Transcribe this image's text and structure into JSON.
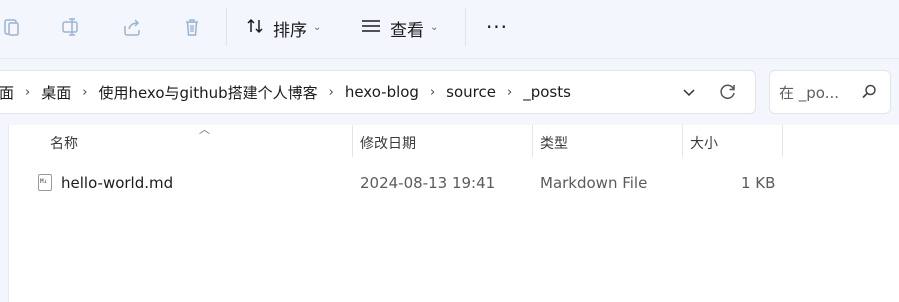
{
  "toolbar": {
    "sort_label": "排序",
    "view_label": "查看",
    "more_label": "···"
  },
  "address": {
    "crumbs": [
      "面",
      "桌面",
      "使用hexo与github搭建个人博客",
      "hexo-blog",
      "source",
      "_posts"
    ],
    "separator": "›"
  },
  "search": {
    "placeholder": "在 _po..."
  },
  "columns": {
    "name": "名称",
    "modified": "修改日期",
    "type": "类型",
    "size": "大小"
  },
  "files": [
    {
      "name": "hello-world.md",
      "modified": "2024-08-13  19:41",
      "type": "Markdown File",
      "size": "1 KB",
      "icon": "markdown-file-icon"
    }
  ],
  "colors": {
    "chrome_bg": "#f3f6fc",
    "disabled_icon": "#9bb3d3"
  }
}
